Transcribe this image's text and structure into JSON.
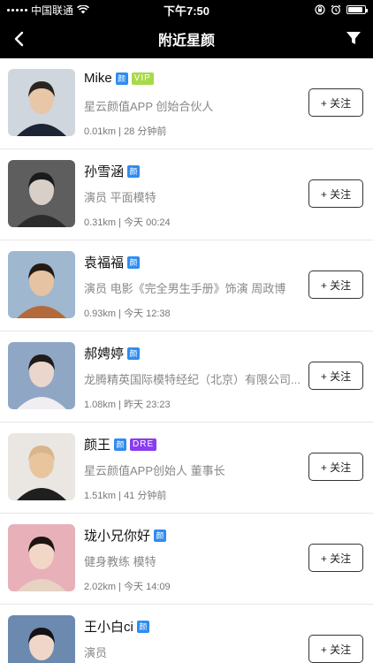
{
  "status_bar": {
    "carrier": "中国联通",
    "time": "下午7:50",
    "battery_level": 0.9
  },
  "nav": {
    "title": "附近星颜",
    "back_icon": "chevron-left-icon",
    "filter_icon": "filter-icon"
  },
  "colors": {
    "verified_badge": "#2f8cf0",
    "vip_badge": "#a8d94a",
    "dre_badge": "#8a3cf0"
  },
  "users": [
    {
      "name": "Mike",
      "verified": "颜",
      "badge": "VIP",
      "desc": "星云颜值APP 创始合伙人",
      "distance": "0.01km",
      "time": "28 分钟前",
      "follow": "+ 关注"
    },
    {
      "name": "孙雪涵",
      "verified": "颜",
      "badge": "",
      "desc": "演员 平面模特",
      "distance": "0.31km",
      "time": "今天 00:24",
      "follow": "+ 关注"
    },
    {
      "name": "袁福福",
      "verified": "颜",
      "badge": "",
      "desc": "演员  电影《完全男生手册》饰演 周政博",
      "distance": "0.93km",
      "time": "今天 12:38",
      "follow": "+ 关注"
    },
    {
      "name": "郝娉婷",
      "verified": "颜",
      "badge": "",
      "desc": "龙腾精英国际模特经纪（北京）有限公司...",
      "distance": "1.08km",
      "time": "昨天 23:23",
      "follow": "+ 关注"
    },
    {
      "name": "颜王",
      "verified": "颜",
      "badge": "DRE",
      "desc": "星云颜值APP创始人 董事长",
      "distance": "1.51km",
      "time": "41 分钟前",
      "follow": "+ 关注"
    },
    {
      "name": "珑小兄你好",
      "verified": "颜",
      "badge": "",
      "desc": "健身教练 模特",
      "distance": "2.02km",
      "time": "今天 14:09",
      "follow": "+ 关注"
    },
    {
      "name": "王小白ci",
      "verified": "颜",
      "badge": "",
      "desc": "演员",
      "distance": "",
      "time": "",
      "follow": "+ 关注"
    }
  ],
  "meta_separator": " | "
}
